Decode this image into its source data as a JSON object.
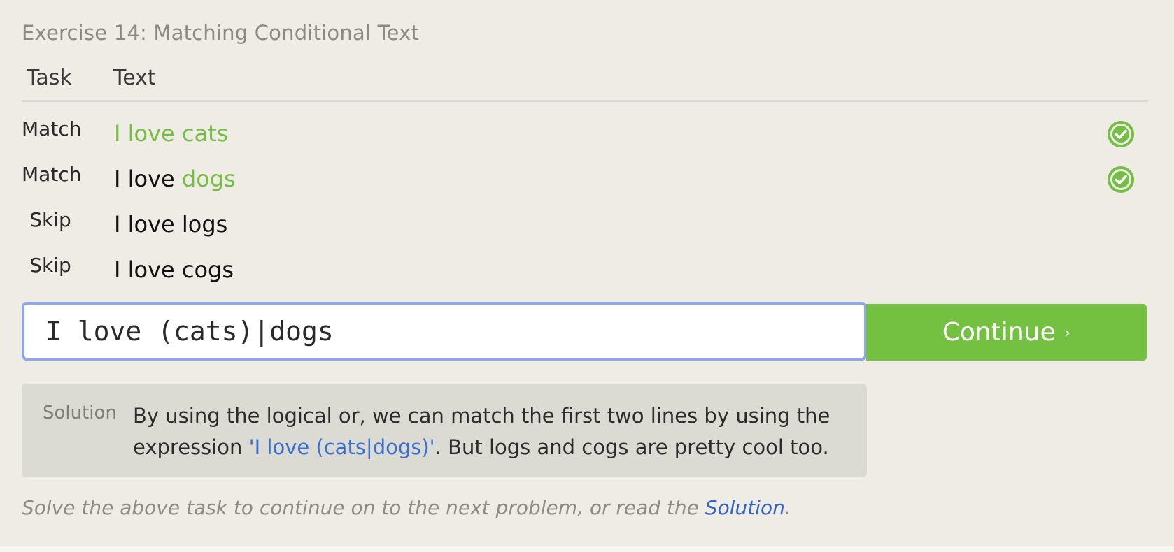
{
  "exercise": {
    "title": "Exercise 14: Matching Conditional Text"
  },
  "table": {
    "headers": {
      "task": "Task",
      "text": "Text"
    },
    "rows": [
      {
        "task": "Match",
        "pre": "",
        "hl": "I love cats",
        "passed": true
      },
      {
        "task": "Match",
        "pre": "I love ",
        "hl": "dogs",
        "passed": true
      },
      {
        "task": "Skip",
        "pre": "I love logs",
        "hl": "",
        "passed": false
      },
      {
        "task": "Skip",
        "pre": "I love cogs",
        "hl": "",
        "passed": false
      }
    ]
  },
  "input": {
    "value": "I love (cats)|dogs"
  },
  "continue_button": {
    "label": "Continue",
    "chevron": "›"
  },
  "solution": {
    "label": "Solution",
    "text_before": "By using the logical or, we can match the first two lines by using the expression ",
    "code": "'I love (cats|dogs)'",
    "text_after": ". But logs and cogs are pretty cool too."
  },
  "footer": {
    "text_before": "Solve the above task to continue on to the next problem, or read the ",
    "link": "Solution",
    "text_after": "."
  },
  "colors": {
    "accent_green": "#74c142",
    "highlight_green": "#74bf43",
    "link_blue": "#2f63c4",
    "focus_border": "#8fa7e6"
  },
  "icons": {
    "passed": "check-circle-icon"
  }
}
